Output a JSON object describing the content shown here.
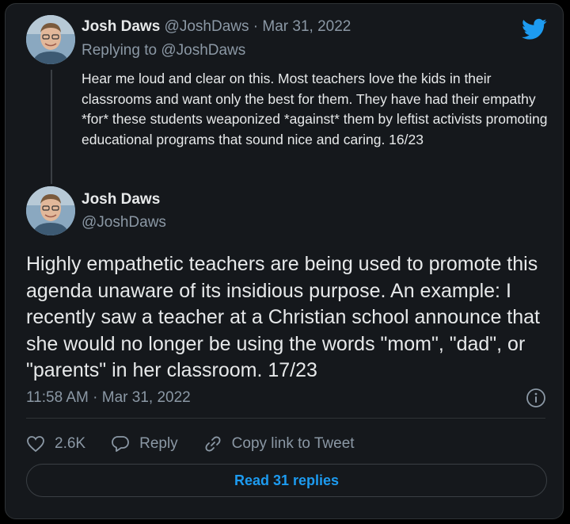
{
  "colors": {
    "accent": "#1d9bf0",
    "background": "#15181c",
    "muted": "#8b98a5",
    "text": "#e7e9ea"
  },
  "quoted_tweet": {
    "author_name": "Josh Daws",
    "author_handle": "@JoshDaws",
    "separator": "·",
    "date": "Mar 31, 2022",
    "replying_prefix": "Replying to",
    "replying_handle": "@JoshDaws",
    "text": "Hear me loud and clear on this. Most teachers love the kids in their classrooms and want only the best for them. They have had their empathy *for* these students weaponized *against* them by leftist activists promoting educational programs that sound nice and caring. 16/23"
  },
  "main_tweet": {
    "author_name": "Josh Daws",
    "author_handle": "@JoshDaws",
    "text": "Highly empathetic teachers are being used to promote this agenda unaware of its insidious purpose. An example: I recently saw a teacher at a Christian school announce that she would no longer be using the words \"mom\", \"dad\", or \"parents\" in her classroom. 17/23",
    "timestamp": "11:58 AM · Mar 31, 2022"
  },
  "actions": {
    "like_count": "2.6K",
    "reply_label": "Reply",
    "copy_link_label": "Copy link to Tweet"
  },
  "read_replies_label": "Read 31 replies",
  "icons": [
    "twitter-bird-icon",
    "info-icon",
    "heart-icon",
    "reply-bubble-icon",
    "link-icon"
  ]
}
